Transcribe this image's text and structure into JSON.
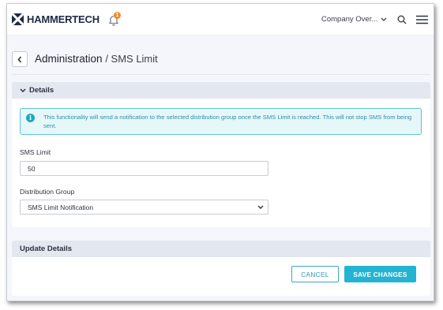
{
  "header": {
    "brand": "HAMMERTECH",
    "notification_count": "1",
    "company_label": "Company Over...",
    "icons": [
      "hammertech-logo-icon",
      "bell-icon",
      "chevron-down-icon",
      "search-icon",
      "hamburger-menu-icon"
    ]
  },
  "page": {
    "title": "Administration",
    "subtitle": "/ SMS Limit"
  },
  "details": {
    "section_label": "Details",
    "info_text": "This functionality will send a notification to the selected distribution group once the SMS Limit is reached. This will not stop SMS from being sent.",
    "sms_limit_label": "SMS Limit",
    "sms_limit_value": "50",
    "distribution_group_label": "Distribution Group",
    "distribution_group_value": "SMS Limit Notification"
  },
  "update": {
    "section_label": "Update Details",
    "cancel_label": "CANCEL",
    "save_label": "SAVE CHANGES"
  },
  "colors": {
    "accent": "#22b4d2",
    "brand": "#1f2a44",
    "badge": "#f08a2c",
    "info_border": "#5ec4d0"
  }
}
